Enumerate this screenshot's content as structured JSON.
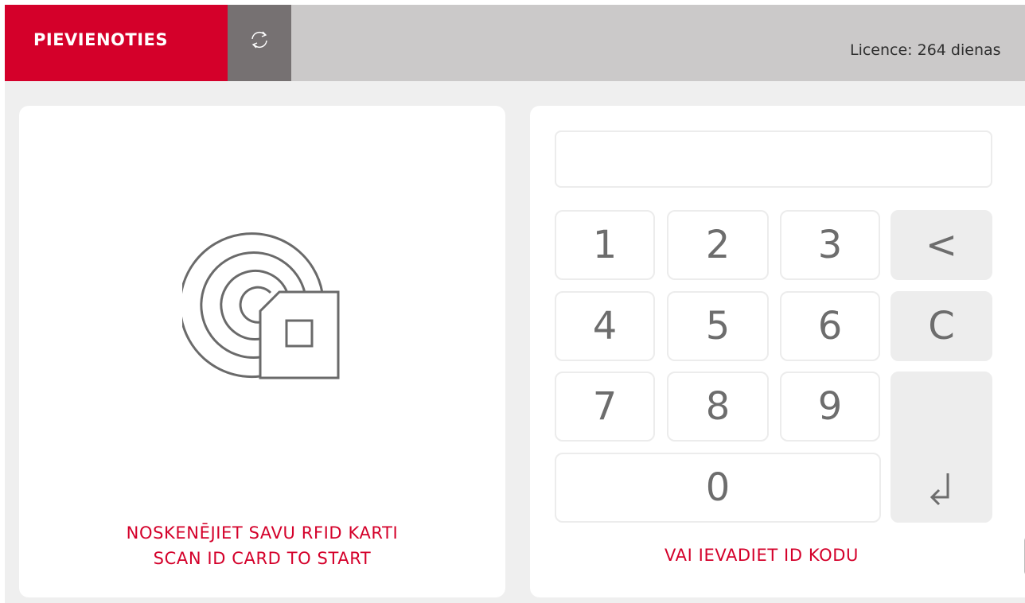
{
  "topbar": {
    "connect_label": "PIEVIENOTIES",
    "refresh_icon": "refresh-icon",
    "license_text": "Licence: 264 dienas"
  },
  "scan_panel": {
    "icon": "rfid-card-icon",
    "line1": "NOSKENĒJIET SAVU RFID KARTI",
    "line2": "SCAN ID CARD TO START"
  },
  "keypad_panel": {
    "code_input": {
      "value": "",
      "placeholder": ""
    },
    "keys": {
      "k1": "1",
      "k2": "2",
      "k3": "3",
      "k4": "4",
      "k5": "5",
      "k6": "6",
      "k7": "7",
      "k8": "8",
      "k9": "9",
      "k0": "0",
      "backspace": "<",
      "clear": "C",
      "enter_icon": "enter-arrow-icon"
    },
    "hint": "VAI IEVADIET ID KODU"
  },
  "colors": {
    "brand_red": "#d4002a",
    "topbar_grey": "#cbc9c9",
    "refresh_grey": "#767172",
    "background": "#efefef"
  }
}
